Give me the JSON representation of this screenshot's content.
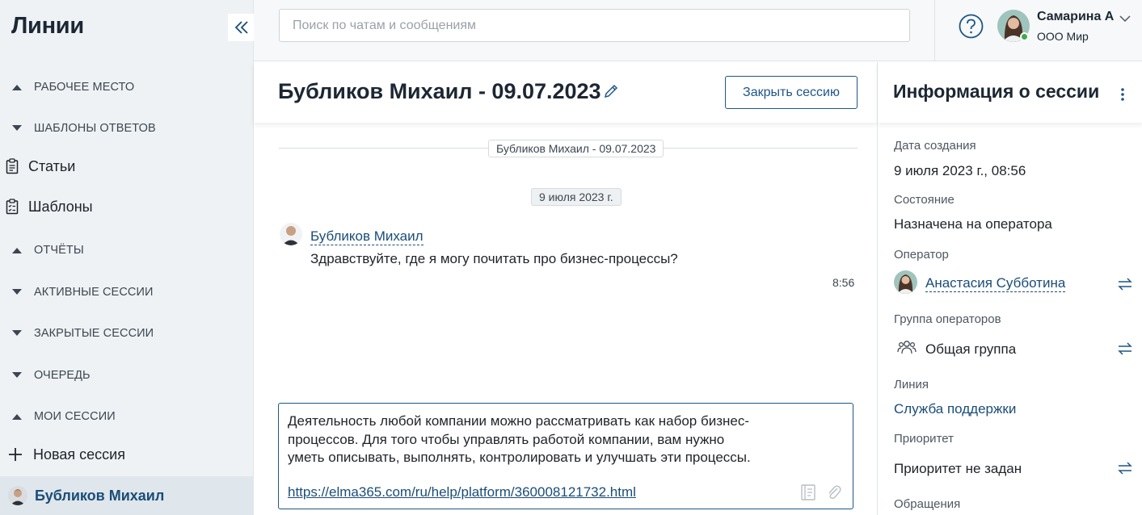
{
  "sidebar": {
    "title": "Линии",
    "items": [
      {
        "label": "РАБОЧЕЕ МЕСТО",
        "kind": "section",
        "expanded": false
      },
      {
        "label": "ШАБЛОНЫ ОТВЕТОВ",
        "kind": "section",
        "expanded": true
      },
      {
        "label": "Статьи",
        "kind": "link",
        "icon": "clipboard-icon"
      },
      {
        "label": "Шаблоны",
        "kind": "link",
        "icon": "clipboard-list-icon"
      },
      {
        "label": "ОТЧЁТЫ",
        "kind": "section",
        "expanded": false
      },
      {
        "label": "АКТИВНЫЕ СЕССИИ",
        "kind": "section",
        "expanded": true
      },
      {
        "label": "ЗАКРЫТЫЕ СЕССИИ",
        "kind": "section",
        "expanded": true
      },
      {
        "label": "ОЧЕРЕДЬ",
        "kind": "section",
        "expanded": true
      },
      {
        "label": "МОИ СЕССИИ",
        "kind": "section",
        "expanded": false
      },
      {
        "label": "Новая сессия",
        "kind": "link",
        "icon": "plus-icon"
      },
      {
        "label": "Бубликов Михаил",
        "kind": "link",
        "icon": "avatar",
        "active": true
      }
    ]
  },
  "topbar": {
    "search_placeholder": "Поиск по чатам и сообщениям",
    "user_name": "Самарина А",
    "user_org": "ООО Мир",
    "online_color": "#3dab4a"
  },
  "chat": {
    "title": "Бубликов Михаил - 09.07.2023",
    "close_button": "Закрыть сессию",
    "session_chip": "Бубликов Михаил - 09.07.2023",
    "date_chip": "9 июля 2023 г.",
    "message": {
      "author": "Бубликов Михаил",
      "text": "Здравствуйте, где я могу почитать про бизнес-процессы?",
      "time": "8:56"
    },
    "composer": {
      "line1": "Деятельность любой компании можно рассматривать как набор бизнес-",
      "line2": "процессов. Для того чтобы управлять работой компании, вам нужно",
      "line3": "уметь описывать, выполнять, контролировать и улучшать эти процессы.",
      "link": "https://elma365.com/ru/help/platform/360008121732.html"
    }
  },
  "info": {
    "title": "Информация о сессии",
    "created_label": "Дата создания",
    "created_value": "9 июля 2023 г., 08:56",
    "state_label": "Состояние",
    "state_value": "Назначена на оператора",
    "operator_label": "Оператор",
    "operator_value": "Анастасия Субботина",
    "group_label": "Группа операторов",
    "group_value": "Общая группа",
    "line_label": "Линия",
    "line_value": "Служба поддержки",
    "priority_label": "Приоритет",
    "priority_value": "Приоритет не задан",
    "requests_label": "Обращения"
  },
  "colors": {
    "accent": "#1f5586",
    "link": "#1a4d77",
    "sidebar_bg": "#eef2f5"
  }
}
